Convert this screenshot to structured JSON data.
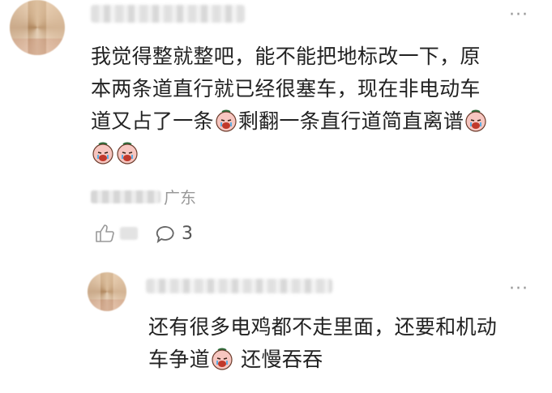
{
  "comments": [
    {
      "more_label": "···",
      "text_lines": [
        "我觉得整就整吧，能不能把地标改一下，原",
        "本两条道直行就已经很塞车，现在非电动车",
        "道又占了一条",
        "剩翻一条直行道简直离谱"
      ],
      "meta_location": "广东",
      "reply_count": "3"
    },
    {
      "more_label": "···",
      "text_line1": "还有很多电鸡都不走里面，还要和机动",
      "text_line2a": "车争道",
      "text_line2b": " 还慢吞吞"
    }
  ],
  "icons": {
    "emoji": "crying-face-emoji",
    "like": "like-thumb-icon",
    "reply": "comment-bubble-icon",
    "more": "more-dots-icon"
  },
  "colors": {
    "text": "#222222",
    "meta": "#9a9a9a",
    "icon": "#777777"
  }
}
